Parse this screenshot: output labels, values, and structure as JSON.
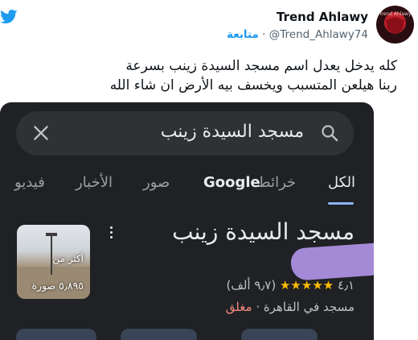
{
  "tweet": {
    "author_name": "Trend Ahlawy",
    "handle": "@Trend_Ahlawy74",
    "follow_label": "متابعة",
    "separator": "·",
    "avatar_text": "Trend Ahlawy",
    "text_line1": "كله يدخل يعدل اسم مسجد السيدة زينب بسرعة",
    "text_line2": "ربنا هيلعن المتسبب ويخسف بيه الأرض ان شاء الله"
  },
  "screenshot": {
    "search_query": "مسجد السيدة زينب",
    "tabs": [
      {
        "label": "الكل",
        "active": true
      },
      {
        "label": "خرائط",
        "active": false
      },
      {
        "label": "Google",
        "active": false
      },
      {
        "label": "صور",
        "active": false
      },
      {
        "label": "الأخبار",
        "active": false
      },
      {
        "label": "فيديو",
        "active": false
      }
    ],
    "place": {
      "title": "مسجد السيدة زينب",
      "rating": "٤٫١",
      "stars": "★★★★★",
      "reviews": "(٩٫٧ ألف)",
      "category": "مسجد في القاهرة",
      "dot": "·",
      "status": "مغلق",
      "photo_caption_top": "أكثر من",
      "photo_caption_bottom": "٥٫٨٩٥ صورة"
    }
  },
  "colors": {
    "twitter_blue": "#1d9bf0",
    "card_bg": "#202124",
    "search_bg": "#303134",
    "star": "#fbbc04",
    "closed": "#f28b82",
    "tab_underline": "#8ab4f8",
    "blur_overlay": "#a48ad6"
  }
}
